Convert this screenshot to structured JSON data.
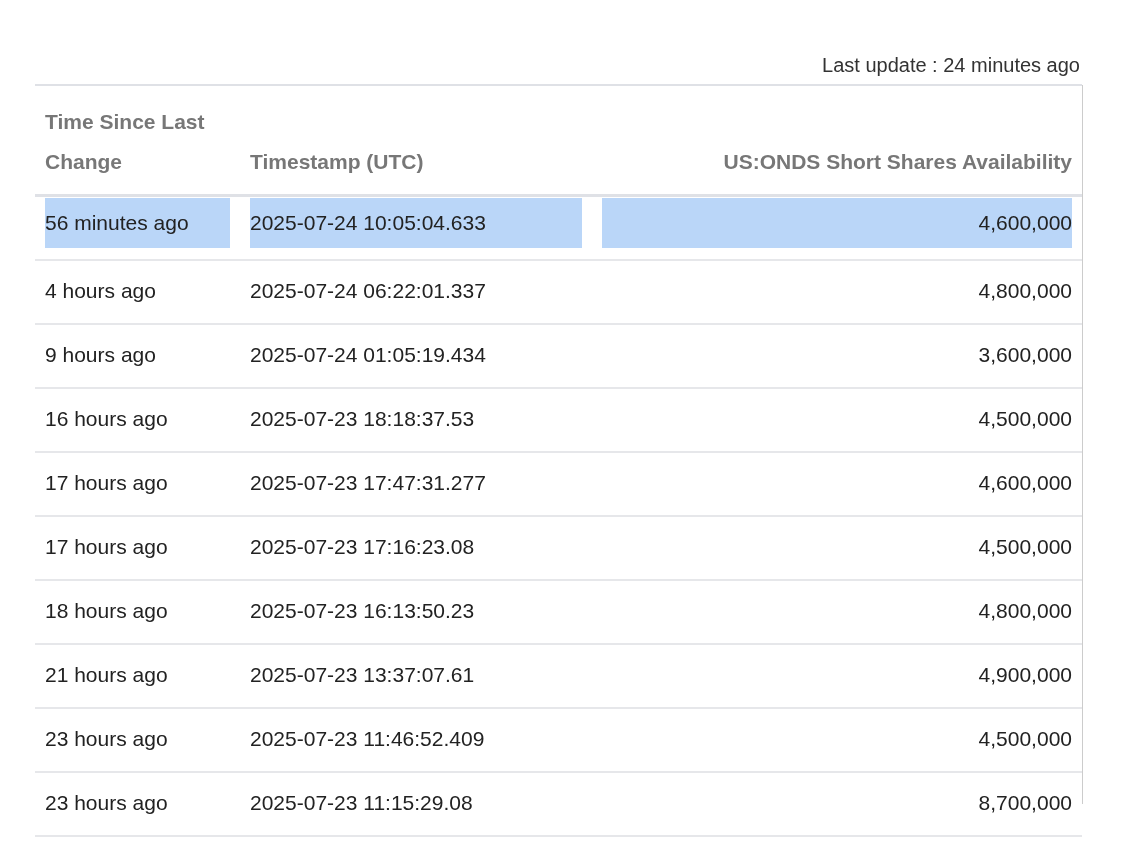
{
  "last_update": "Last update : 24 minutes ago",
  "table": {
    "columns": [
      "Time Since Last Change",
      "Timestamp (UTC)",
      "US:ONDS Short Shares Availability"
    ],
    "rows": [
      {
        "selected": true,
        "cells": [
          "56 minutes ago",
          "2025-07-24 10:05:04.633",
          "4,600,000"
        ]
      },
      {
        "selected": false,
        "cells": [
          "4 hours ago",
          "2025-07-24 06:22:01.337",
          "4,800,000"
        ]
      },
      {
        "selected": false,
        "cells": [
          "9 hours ago",
          "2025-07-24 01:05:19.434",
          "3,600,000"
        ]
      },
      {
        "selected": false,
        "cells": [
          "16 hours ago",
          "2025-07-23 18:18:37.53",
          "4,500,000"
        ]
      },
      {
        "selected": false,
        "cells": [
          "17 hours ago",
          "2025-07-23 17:47:31.277",
          "4,600,000"
        ]
      },
      {
        "selected": false,
        "cells": [
          "17 hours ago",
          "2025-07-23 17:16:23.08",
          "4,500,000"
        ]
      },
      {
        "selected": false,
        "cells": [
          "18 hours ago",
          "2025-07-23 16:13:50.23",
          "4,800,000"
        ]
      },
      {
        "selected": false,
        "cells": [
          "21 hours ago",
          "2025-07-23 13:37:07.61",
          "4,900,000"
        ]
      },
      {
        "selected": false,
        "cells": [
          "23 hours ago",
          "2025-07-23 11:46:52.409",
          "4,500,000"
        ]
      },
      {
        "selected": false,
        "cells": [
          "23 hours ago",
          "2025-07-23 11:15:29.08",
          "8,700,000"
        ]
      }
    ]
  }
}
